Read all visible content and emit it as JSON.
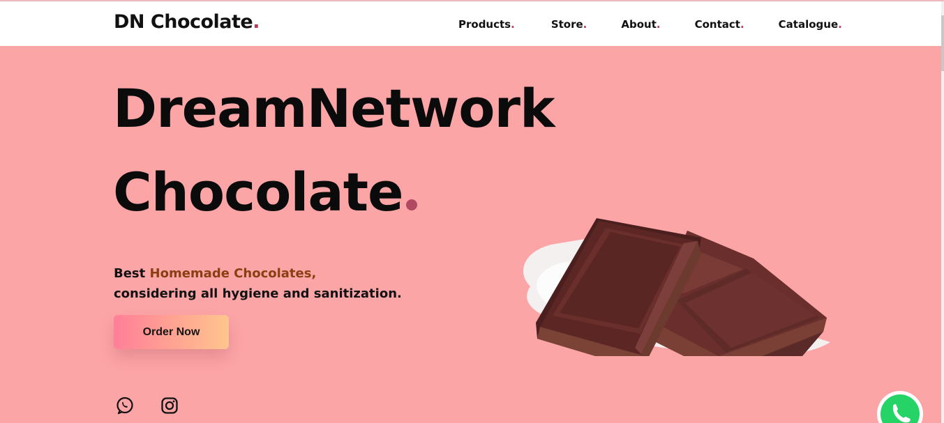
{
  "header": {
    "brand": "DN Chocolate",
    "brand_dot": ".",
    "nav": [
      {
        "label": "Products",
        "dot": "."
      },
      {
        "label": "Store",
        "dot": "."
      },
      {
        "label": "About",
        "dot": "."
      },
      {
        "label": "Contact",
        "dot": "."
      },
      {
        "label": "Catalogue",
        "dot": "."
      }
    ]
  },
  "hero": {
    "title_line1": "DreamNetwork",
    "title_line2": "Chocolate",
    "tagline_prefix": "Best ",
    "tagline_accent": "Homemade Chocolates,",
    "tagline_line2": "considering all hygiene and sanitization.",
    "order_button": "Order Now"
  },
  "icons": {
    "social": [
      "whatsapp-icon",
      "instagram-icon"
    ],
    "floating": "whatsapp-float-icon",
    "image": "chocolate-bar-image"
  },
  "colors": {
    "hero_background": "#fca5a7",
    "accent_dot": "#b83a57",
    "tagline_accent": "#8a3f12",
    "button_gradient_start": "#ff7f98",
    "button_gradient_end": "#ffc58d",
    "whatsapp_green": "#25d366"
  }
}
